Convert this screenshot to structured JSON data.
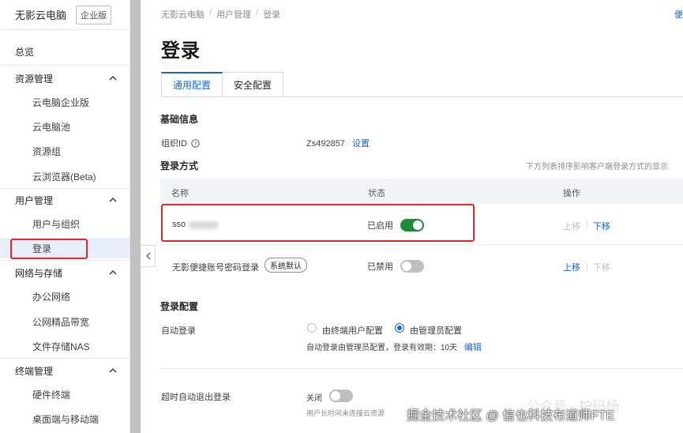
{
  "brand": {
    "name": "无影云电脑",
    "tag": "企业版"
  },
  "sidebar": {
    "overview": "总览",
    "groups": [
      {
        "label": "资源管理",
        "items": [
          "云电脑企业版",
          "云电脑池",
          "资源组",
          "云浏览器(Beta)"
        ]
      },
      {
        "label": "用户管理",
        "items": [
          "用户与组织",
          "登录"
        ]
      },
      {
        "label": "网络与存储",
        "items": [
          "办公网络",
          "公网精品带宽",
          "文件存储NAS"
        ]
      },
      {
        "label": "终端管理",
        "items": [
          "硬件终端",
          "桌面端与移动端"
        ]
      }
    ],
    "active_item": "登录"
  },
  "breadcrumb": [
    "无影云电脑",
    "用户管理",
    "登录"
  ],
  "top_right_text": "便",
  "page_title": "登录",
  "tabs": [
    {
      "label": "通用配置",
      "active": true
    },
    {
      "label": "安全配置",
      "active": false
    }
  ],
  "basic_info": {
    "title": "基础信息",
    "org_id_label": "组织ID",
    "org_id_value": "Zs492857",
    "org_id_action": "设置"
  },
  "login_methods": {
    "title": "登录方式",
    "hint": "下方列表排序影响客户端登录方式的显示",
    "columns": [
      "名称",
      "状态",
      "操作"
    ],
    "rows": [
      {
        "name": "sso",
        "status": "已启用",
        "enabled": true,
        "move_up": "上移",
        "move_down": "下移"
      },
      {
        "name": "无影便捷账号密码登录",
        "badge": "系统默认",
        "status": "已禁用",
        "enabled": false,
        "move_up": "上移",
        "move_down": "下移"
      }
    ]
  },
  "login_config": {
    "title": "登录配置",
    "auto_login_label": "自动登录",
    "option_user": "由终端用户配置",
    "option_admin": "由管理员配置",
    "selected": "由管理员配置",
    "desc": "自动登录由管理员配置，登录有效期：10天",
    "edit": "编辑",
    "timeout_label": "超时自动退出登录",
    "timeout_state": "关闭",
    "timeout_desc": "用户长时间未连接云资源"
  },
  "watermark": {
    "back": "公众号 · 护码杨",
    "front": "掘金技术社区 @ 信也科技布道师FTE"
  },
  "colors": {
    "accent": "#1765c8",
    "toggle_on": "#1f8a3b",
    "highlight": "#e5262d"
  }
}
